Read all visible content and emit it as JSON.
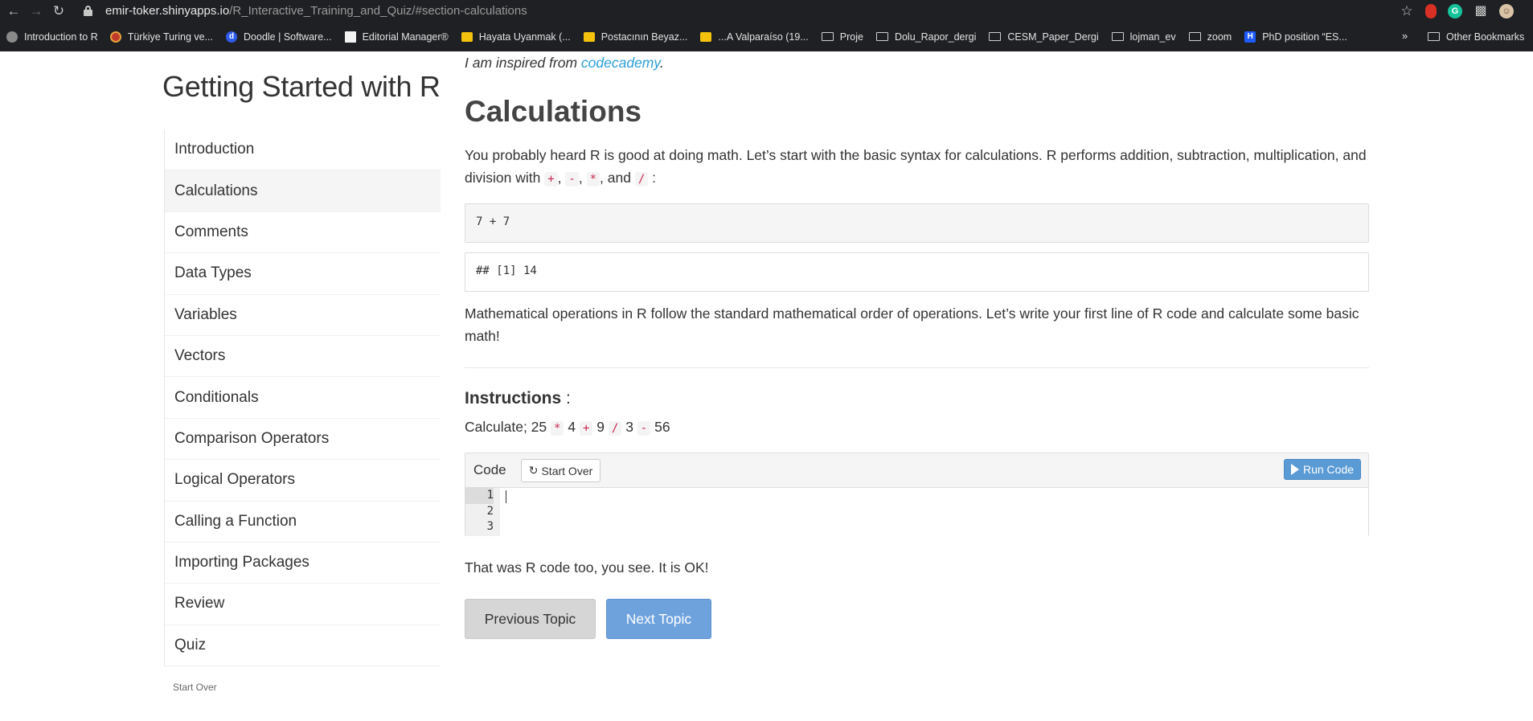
{
  "browser": {
    "url_host": "emir-toker.shinyapps.io",
    "url_path": "/R_Interactive_Training_and_Quiz/#section-calculations",
    "bookmarks": [
      {
        "label": "Introduction to R",
        "icon": "r-icon"
      },
      {
        "label": "Türkiye Turing ve...",
        "icon": "turing-icon"
      },
      {
        "label": "Doodle | Software...",
        "icon": "doodle-icon"
      },
      {
        "label": "Editorial Manager®",
        "icon": "editorial-icon"
      },
      {
        "label": "Hayata Uyanmak (...",
        "icon": "yellow-icon"
      },
      {
        "label": "Postacının Beyaz...",
        "icon": "yellow-icon"
      },
      {
        "label": "...A Valparaíso (19...",
        "icon": "yellow-icon"
      },
      {
        "label": "Proje",
        "icon": "folder-icon"
      },
      {
        "label": "Dolu_Rapor_dergi",
        "icon": "folder-icon"
      },
      {
        "label": "CESM_Paper_Dergi",
        "icon": "folder-icon"
      },
      {
        "label": "lojman_ev",
        "icon": "folder-icon"
      },
      {
        "label": "zoom",
        "icon": "folder-icon"
      },
      {
        "label": "PhD position “ES...",
        "icon": "phd-icon"
      }
    ],
    "overflow": "»",
    "other_bookmarks": "Other Bookmarks"
  },
  "sidebar": {
    "title": "Getting Started with R",
    "items": [
      {
        "label": "Introduction"
      },
      {
        "label": "Calculations"
      },
      {
        "label": "Comments"
      },
      {
        "label": "Data Types"
      },
      {
        "label": "Variables"
      },
      {
        "label": "Vectors"
      },
      {
        "label": "Conditionals"
      },
      {
        "label": "Comparison Operators"
      },
      {
        "label": "Logical Operators"
      },
      {
        "label": "Calling a Function"
      },
      {
        "label": "Importing Packages"
      },
      {
        "label": "Review"
      },
      {
        "label": "Quiz"
      }
    ],
    "active_index": 1,
    "start_over": "Start Over"
  },
  "main": {
    "intro_prefix": "I am inspired from ",
    "intro_link": "codecademy",
    "intro_suffix": ".",
    "heading": "Calculations",
    "para1_a": "You probably heard R is good at doing math. Let’s start with the basic syntax for calculations. R performs addition, subtraction, multiplication, and division with ",
    "op_plus": "+",
    "op_minus": "-",
    "op_times": "*",
    "op_div": "/",
    "sep_comma": ",",
    "sep_and": ", and",
    "para1_end": ":",
    "code": "7 + 7",
    "output": "## [1] 14",
    "para2": "Mathematical operations in R follow the standard mathematical order of operations. Let’s write your first line of R code and calculate some basic math!",
    "instructions_label": "Instructions",
    "instructions_suffix": " :",
    "calc_prefix": "Calculate; 25",
    "calc_n1": "4",
    "calc_n2": "9",
    "calc_n3": "3",
    "calc_n4": "56",
    "exercise": {
      "title": "Code",
      "start_over": "Start Over",
      "run": "Run Code",
      "line_numbers": [
        "1",
        "2",
        "3"
      ]
    },
    "para3": "That was R code too, you see. It is OK!",
    "prev_button": "Previous Topic",
    "next_button": "Next Topic"
  }
}
